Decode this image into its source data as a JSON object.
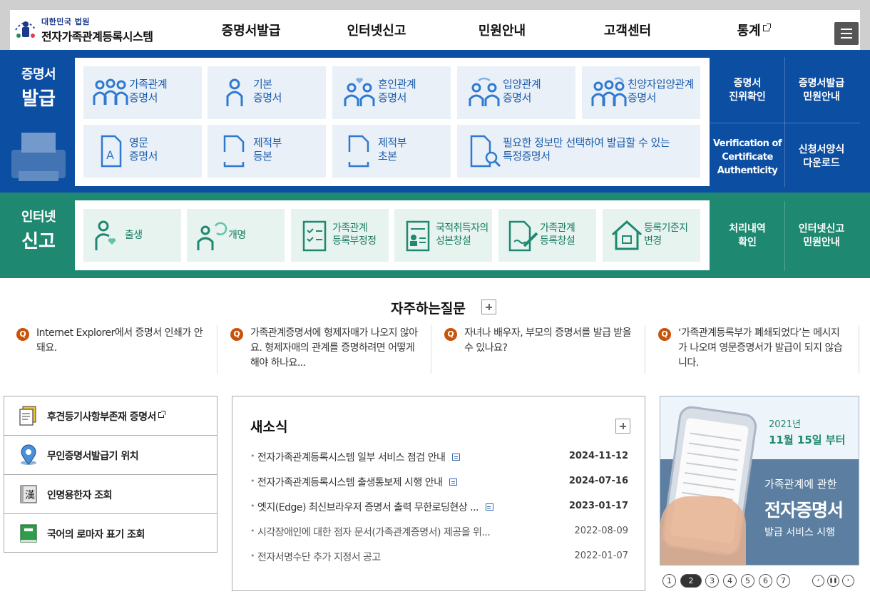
{
  "header": {
    "logo_sub": "대한민국 법원",
    "logo_title": "전자가족관계등록시스템",
    "nav": [
      "증명서발급",
      "인터넷신고",
      "민원안내",
      "고객센터",
      "통계"
    ]
  },
  "issue": {
    "title_small": "증명서",
    "title_big": "발급",
    "cards": [
      {
        "l1": "가족관계",
        "l2": "증명서"
      },
      {
        "l1": "기본",
        "l2": "증명서"
      },
      {
        "l1": "혼인관계",
        "l2": "증명서"
      },
      {
        "l1": "입양관계",
        "l2": "증명서"
      },
      {
        "l1": "친양자입양관계",
        "l2": "증명서"
      },
      {
        "l1": "영문",
        "l2": "증명서"
      },
      {
        "l1": "제적부",
        "l2": "등본"
      },
      {
        "l1": "제적부",
        "l2": "초본"
      },
      {
        "l1": "필요한 정보만 선택하여 발급할 수 있는",
        "l2": "특정증명서"
      }
    ],
    "quick": [
      {
        "l1": "증명서",
        "l2": "진위확인"
      },
      {
        "l1": "증명서발급",
        "l2": "민원안내"
      },
      {
        "l1": "Verification of",
        "l2": "Certificate",
        "l3": "Authenticity"
      },
      {
        "l1": "신청서양식",
        "l2": "다운로드"
      }
    ]
  },
  "report": {
    "title_small": "인터넷",
    "title_big": "신고",
    "cards": [
      {
        "l1": "출생",
        "l2": ""
      },
      {
        "l1": "개명",
        "l2": ""
      },
      {
        "l1": "가족관계",
        "l2": "등록부정정"
      },
      {
        "l1": "국적취득자의",
        "l2": "성본창설"
      },
      {
        "l1": "가족관계",
        "l2": "등록창설"
      },
      {
        "l1": "등록기준지",
        "l2": "변경"
      }
    ],
    "quick": [
      {
        "l1": "처리내역",
        "l2": "확인"
      },
      {
        "l1": "인터넷신고",
        "l2": "민원안내"
      }
    ]
  },
  "faq": {
    "title": "자주하는질문",
    "badge": "Q",
    "items": [
      "Internet Explorer에서 증명서 인쇄가 안돼요.",
      "가족관계증명서에 형제자매가 나오지 않아요. 형제자매의 관계를 증명하려면 어떻게 해야 하나요...",
      "자녀나 배우자, 부모의 증명서를 발급 받을 수 있나요?",
      "‘가족관계등록부가 폐쇄되었다’는 메시지가 나오며 영문증명서가 발급이 되지 않습니다."
    ]
  },
  "links": [
    "후견등기사항부존재 증명서",
    "무인증명서발급기 위치",
    "인명용한자 조회",
    "국어의 로마자 표기 조회"
  ],
  "news": {
    "title": "새소식",
    "items": [
      {
        "title": "전자가족관계등록시스템 일부 서비스 점검 안내",
        "date": "2024-11-12",
        "isnew": true
      },
      {
        "title": "전자가족관계등록시스템 출생통보제 시행 안내",
        "date": "2024-07-16",
        "isnew": true
      },
      {
        "title": "엣지(Edge) 최신브라우저 증명서 출력 무한로딩현상 ...",
        "date": "2023-01-17",
        "isnew": true
      },
      {
        "title": "시각장애인에 대한 점자 문서(가족관계증명서) 제공을 위...",
        "date": "2022-08-09",
        "isnew": false
      },
      {
        "title": "전자서명수단 추가 지정서 공고",
        "date": "2022-01-07",
        "isnew": false
      }
    ]
  },
  "banner": {
    "year": "2021년",
    "date": "11월 15일 부터",
    "line1": "가족관계에 관한",
    "line2": "전자증명서",
    "line3": "발급 서비스 시행",
    "pages": [
      "1",
      "2",
      "3",
      "4",
      "5",
      "6",
      "7"
    ],
    "active_page": 2,
    "controls": [
      "‹",
      "❚❚",
      "›"
    ]
  },
  "colors": {
    "issue_band": "#0b4ea2",
    "report_band": "#1f8870",
    "faq_badge": "#c8540c"
  }
}
